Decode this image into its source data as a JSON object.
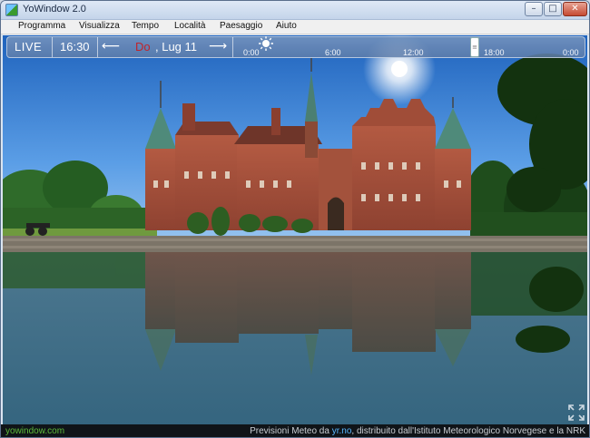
{
  "window": {
    "title": "YoWindow 2.0",
    "minimize_glyph": "–",
    "maximize_glyph": "□",
    "close_glyph": "✕"
  },
  "menu": {
    "items": [
      "Programma",
      "Visualizza",
      "Tempo",
      "Località",
      "Paesaggio",
      "Aiuto"
    ]
  },
  "toolbar": {
    "live_label": "LIVE",
    "time": "16:30",
    "prev_glyph": "⟵",
    "next_glyph": "⟶",
    "date_day": "Do",
    "date_rest": ", Lug 11",
    "timeline_labels": [
      "0:00",
      "6:00",
      "12:00",
      "18:00",
      "0:00"
    ],
    "timeline_handle_glyph": "≡",
    "weather_icon": "sun-icon"
  },
  "footer": {
    "site": "yowindow.com",
    "forecast_prefix": "Previsioni Meteo da ",
    "forecast_link": "yr.no",
    "forecast_suffix": ", distribuito dall'Istituto Meteorologico Norvegese e la NRK"
  },
  "colors": {
    "sky_top": "#2f74c9",
    "water": "#2e5a7a",
    "castle_brick": "#a9513c",
    "day_accent": "#c0242b",
    "site_link": "#5dbb3a"
  }
}
